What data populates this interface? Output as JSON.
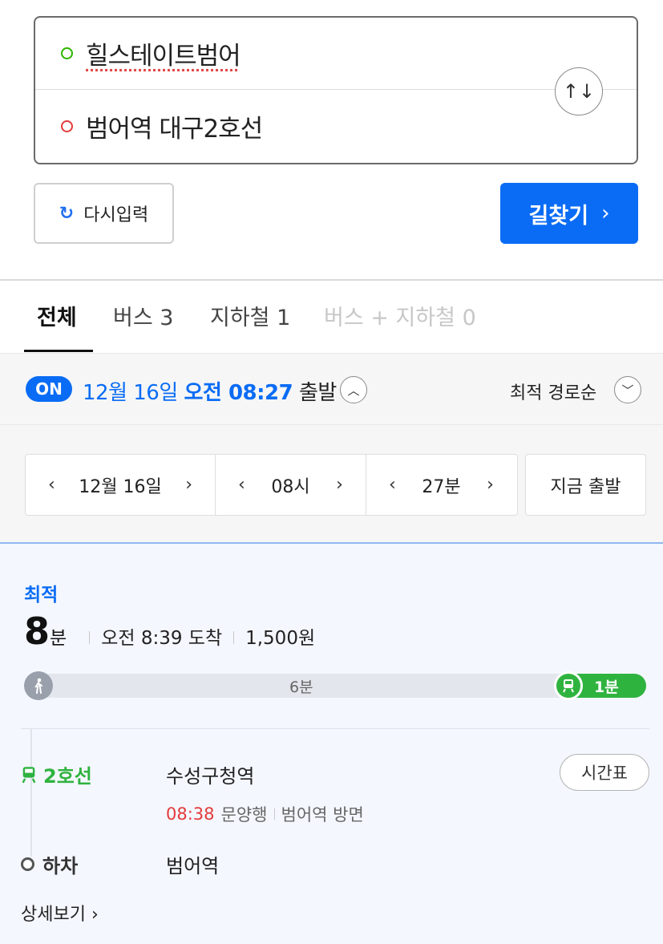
{
  "route": {
    "origin": "힐스테이트범어",
    "destination": "범어역 대구2호선",
    "swap_icon": "↑↓"
  },
  "actions": {
    "reset_icon": "↻",
    "reset_label": "다시입력",
    "search_label": "길찾기",
    "search_chevron": "›"
  },
  "tabs": [
    {
      "label": "전체"
    },
    {
      "label": "버스 3"
    },
    {
      "label": "지하철 1"
    },
    {
      "label": "버스 + 지하철 0"
    }
  ],
  "time_bar": {
    "on_label": "ON",
    "date": "12월 16일",
    "time": "오전 08:27",
    "depart_word": "출발",
    "expand_icon": "︿",
    "sort_label": "최적 경로순",
    "sort_icon": "﹀"
  },
  "picker": {
    "prev": "‹",
    "next": "›",
    "date": "12월 16일",
    "hour": "08시",
    "minute": "27분",
    "now_label": "지금 출발"
  },
  "result": {
    "badge": "최적",
    "duration_num": "8",
    "duration_unit": "분",
    "arrival": "오전 8:39 도착",
    "fare": "1,500원",
    "walk_icon": "🚶",
    "walk_duration": "6분",
    "subway_icon": "🚆",
    "subway_duration": "1분",
    "line": "2호선",
    "line_icon": "🚆",
    "board_station": "수성구청역",
    "timetable_label": "시간표",
    "next_train_time": "08:38",
    "direction": "문양행",
    "platform": "범어역 방면",
    "alight_label": "하차",
    "alight_station": "범어역",
    "detail_link": "상세보기 ›"
  },
  "colors": {
    "accent": "#0a6cf5",
    "line2_green": "#2fb33f",
    "origin_dot": "#2db400",
    "dest_dot": "#e33b3b",
    "train_time": "#e33b3b"
  }
}
